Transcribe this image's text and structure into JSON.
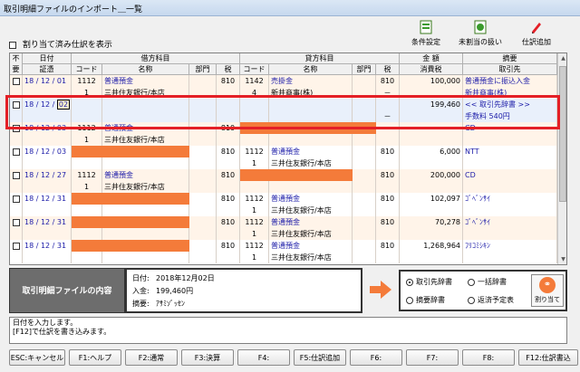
{
  "window": {
    "title": "取引明細ファイルのインポート＿一覧"
  },
  "toolbar": {
    "condition_label": "条件設定",
    "unassigned_label": "未割当の扱い",
    "add_entry_label": "仕訳追加"
  },
  "filter": {
    "show_assigned_label": "割り当て済み仕訳を表示"
  },
  "grid": {
    "header": {
      "unnecessary": "不要",
      "date": "日付",
      "voucher": "証憑",
      "debit": "借方科目",
      "credit": "貸方科目",
      "code": "コード",
      "name": "名称",
      "dept": "部門",
      "tax": "税",
      "amount": "金 額",
      "tax_amount": "消費税",
      "summary": "摘要",
      "partner": "取引先"
    },
    "rows": [
      {
        "date": "18 / 12 / 01",
        "dcode": "1112",
        "dname": "普通預金",
        "dtax": "810",
        "ccode": "1142",
        "cname": "売掛金",
        "ctax": "810",
        "amount": "100,000",
        "summary": "普通預金に振込入金"
      },
      {
        "dcode": "1",
        "dname": "三井住友銀行/本店",
        "ccode": "4",
        "cname": "新井商事(株)",
        "ctax_flag": "－",
        "summary": "新井商事(株)"
      },
      {
        "date": "18 / 12 / ",
        "date_edit": "02",
        "amount": "199,460",
        "summary": "<< 取引先辞書 >>"
      },
      {
        "ctax_flag": "－",
        "summary": "手数料 540円"
      },
      {
        "date": "18 / 12 / 03",
        "dcode": "1112",
        "dname": "普通預金",
        "dtax": "810",
        "amount": "",
        "summary": "CD"
      },
      {
        "dcode": "1",
        "dname": "三井住友銀行/本店"
      },
      {
        "date": "18 / 12 / 03",
        "dtax": "810",
        "ccode": "1112",
        "cname": "普通預金",
        "ctax": "810",
        "amount": "6,000",
        "summary": "NTT"
      },
      {
        "ccode": "1",
        "cname": "三井住友銀行/本店"
      },
      {
        "date": "18 / 12 / 27",
        "dcode": "1112",
        "dname": "普通預金",
        "dtax": "810",
        "ctax": "810",
        "amount": "200,000",
        "summary": "CD"
      },
      {
        "dcode": "1",
        "dname": "三井住友銀行/本店"
      },
      {
        "date": "18 / 12 / 31",
        "dtax": "810",
        "ccode": "1112",
        "cname": "普通預金",
        "ctax": "810",
        "amount": "102,097",
        "summary": "ｺﾞﾍﾞﾝｻｲ"
      },
      {
        "ccode": "1",
        "cname": "三井住友銀行/本店"
      },
      {
        "date": "18 / 12 / 31",
        "dtax": "810",
        "ccode": "1112",
        "cname": "普通預金",
        "ctax": "810",
        "amount": "70,278",
        "summary": "ｺﾞﾍﾞﾝｻｲ"
      },
      {
        "ccode": "1",
        "cname": "三井住友銀行/本店"
      },
      {
        "date": "18 / 12 / 31",
        "dtax": "810",
        "ccode": "1112",
        "cname": "普通預金",
        "ctax": "810",
        "amount": "1,268,964",
        "summary": "ﾌﾘｺﾐｼｷﾝ"
      },
      {
        "ccode": "1",
        "cname": "三井住友銀行/本店"
      }
    ]
  },
  "file_panel": {
    "title": "取引明細ファイルの内容",
    "date_label": "日付:",
    "date_value": "2018年12月02日",
    "deposit_label": "入金:",
    "deposit_value": "199,460円",
    "summary_label": "摘要:",
    "summary_value": "ｱｻﾐｿﾞｯｾﾝ"
  },
  "options": {
    "partner_dict": "取引先辞書",
    "bulk_dict": "一括辞書",
    "summary_dict": "摘要辞書",
    "repay_schedule": "返済予定表",
    "assign_label": "割り当て"
  },
  "messages": {
    "line1": "日付を入力します。",
    "line2": "[F12]で仕訳を書き込みます。"
  },
  "fkeys": [
    "ESC:キャンセル",
    "F1:ヘルプ",
    "F2:通常",
    "F3:決算",
    "F4:",
    "F5:仕訳追加",
    "F6:",
    "F7:",
    "F8:",
    "F12:仕訳書込"
  ],
  "colors": {
    "accent_orange": "#f47b3a",
    "highlight_red": "#e41f26",
    "row_tint": "#fff4e9"
  }
}
